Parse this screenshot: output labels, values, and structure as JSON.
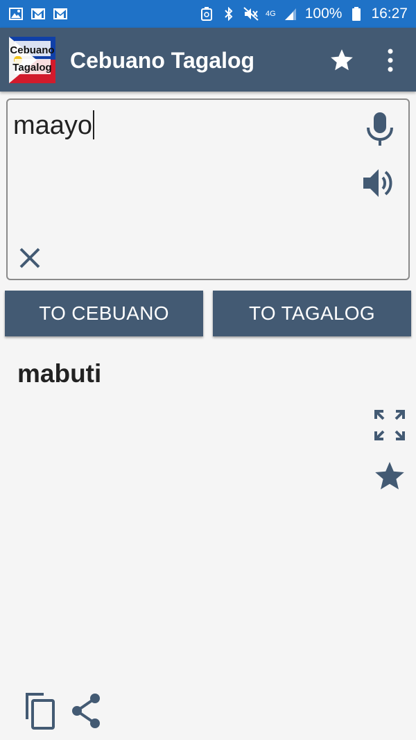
{
  "status_bar": {
    "network": "4G",
    "battery": "100%",
    "time": "16:27"
  },
  "app_bar": {
    "title": "Cebuano Tagalog",
    "logo_line1": "Cebuano",
    "logo_line2": "Tagalog"
  },
  "input": {
    "value": "maayo"
  },
  "buttons": {
    "to_cebuano": "TO CEBUANO",
    "to_tagalog": "TO TAGALOG"
  },
  "result": {
    "text": "mabuti"
  },
  "colors": {
    "status_bar": "#1f72c7",
    "primary": "#435a73",
    "background": "#f5f5f5"
  },
  "icons": [
    "image-icon",
    "gmail-icon",
    "gmail-icon",
    "recycle-icon",
    "bluetooth-icon",
    "mute-icon",
    "signal-icon",
    "battery-icon",
    "star-icon",
    "more-vert-icon",
    "mic-icon",
    "speaker-icon",
    "close-icon",
    "fullscreen-icon",
    "star-icon",
    "copy-icon",
    "share-icon"
  ]
}
